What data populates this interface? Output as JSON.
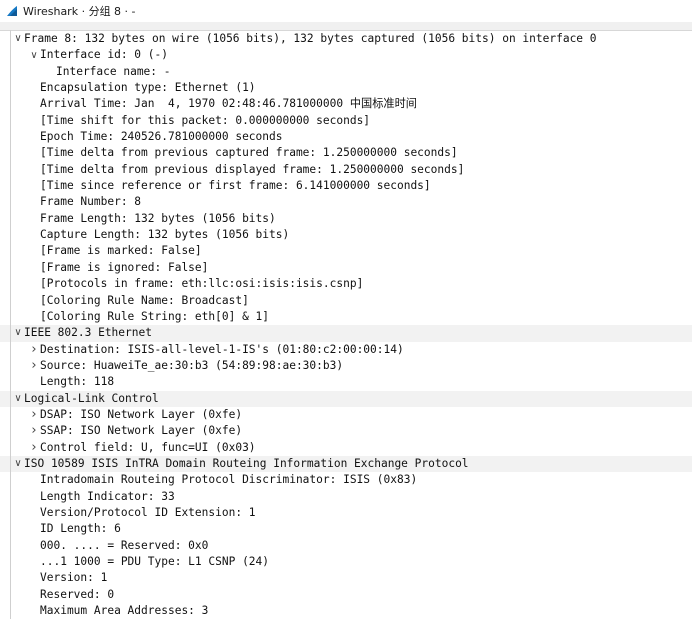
{
  "window": {
    "title": "Wireshark · 分组 8 · -",
    "app_icon": "wireshark-fin-icon",
    "accent_color": "#1679c5"
  },
  "tree": [
    {
      "text": "Frame 8: 132 bytes on wire (1056 bits), 132 bytes captured (1056 bits) on interface 0",
      "level": 0,
      "toggle": "expanded",
      "band": "top"
    },
    {
      "text": "Interface id: 0 (-)",
      "level": 1,
      "toggle": "expanded"
    },
    {
      "text": "Interface name: -",
      "level": 2,
      "toggle": "none"
    },
    {
      "text": "Encapsulation type: Ethernet (1)",
      "level": 1,
      "toggle": "none"
    },
    {
      "text": "Arrival Time: Jan  4, 1970 02:48:46.781000000 中国标准时间",
      "level": 1,
      "toggle": "none"
    },
    {
      "text": "[Time shift for this packet: 0.000000000 seconds]",
      "level": 1,
      "toggle": "none"
    },
    {
      "text": "Epoch Time: 240526.781000000 seconds",
      "level": 1,
      "toggle": "none"
    },
    {
      "text": "[Time delta from previous captured frame: 1.250000000 seconds]",
      "level": 1,
      "toggle": "none"
    },
    {
      "text": "[Time delta from previous displayed frame: 1.250000000 seconds]",
      "level": 1,
      "toggle": "none"
    },
    {
      "text": "[Time since reference or first frame: 6.141000000 seconds]",
      "level": 1,
      "toggle": "none"
    },
    {
      "text": "Frame Number: 8",
      "level": 1,
      "toggle": "none"
    },
    {
      "text": "Frame Length: 132 bytes (1056 bits)",
      "level": 1,
      "toggle": "none"
    },
    {
      "text": "Capture Length: 132 bytes (1056 bits)",
      "level": 1,
      "toggle": "none"
    },
    {
      "text": "[Frame is marked: False]",
      "level": 1,
      "toggle": "none"
    },
    {
      "text": "[Frame is ignored: False]",
      "level": 1,
      "toggle": "none"
    },
    {
      "text": "[Protocols in frame: eth:llc:osi:isis:isis.csnp]",
      "level": 1,
      "toggle": "none"
    },
    {
      "text": "[Coloring Rule Name: Broadcast]",
      "level": 1,
      "toggle": "none"
    },
    {
      "text": "[Coloring Rule String: eth[0] & 1]",
      "level": 1,
      "toggle": "none"
    },
    {
      "text": "IEEE 802.3 Ethernet",
      "level": 0,
      "toggle": "expanded",
      "band": "section"
    },
    {
      "text": "Destination: ISIS-all-level-1-IS's (01:80:c2:00:00:14)",
      "level": 1,
      "toggle": "collapsed"
    },
    {
      "text": "Source: HuaweiTe_ae:30:b3 (54:89:98:ae:30:b3)",
      "level": 1,
      "toggle": "collapsed"
    },
    {
      "text": "Length: 118",
      "level": 1,
      "toggle": "none"
    },
    {
      "text": "Logical-Link Control",
      "level": 0,
      "toggle": "expanded",
      "band": "section"
    },
    {
      "text": "DSAP: ISO Network Layer (0xfe)",
      "level": 1,
      "toggle": "collapsed"
    },
    {
      "text": "SSAP: ISO Network Layer (0xfe)",
      "level": 1,
      "toggle": "collapsed"
    },
    {
      "text": "Control field: U, func=UI (0x03)",
      "level": 1,
      "toggle": "collapsed"
    },
    {
      "text": "ISO 10589 ISIS InTRA Domain Routeing Information Exchange Protocol",
      "level": 0,
      "toggle": "expanded",
      "band": "section"
    },
    {
      "text": "Intradomain Routeing Protocol Discriminator: ISIS (0x83)",
      "level": 1,
      "toggle": "none"
    },
    {
      "text": "Length Indicator: 33",
      "level": 1,
      "toggle": "none"
    },
    {
      "text": "Version/Protocol ID Extension: 1",
      "level": 1,
      "toggle": "none"
    },
    {
      "text": "ID Length: 6",
      "level": 1,
      "toggle": "none"
    },
    {
      "text": "000. .... = Reserved: 0x0",
      "level": 1,
      "toggle": "none"
    },
    {
      "text": "...1 1000 = PDU Type: L1 CSNP (24)",
      "level": 1,
      "toggle": "none"
    },
    {
      "text": "Version: 1",
      "level": 1,
      "toggle": "none"
    },
    {
      "text": "Reserved: 0",
      "level": 1,
      "toggle": "none"
    },
    {
      "text": "Maximum Area Addresses: 3",
      "level": 1,
      "toggle": "none"
    }
  ],
  "icons": {
    "expanded": "chevron-down-icon",
    "collapsed": "chevron-right-icon"
  }
}
